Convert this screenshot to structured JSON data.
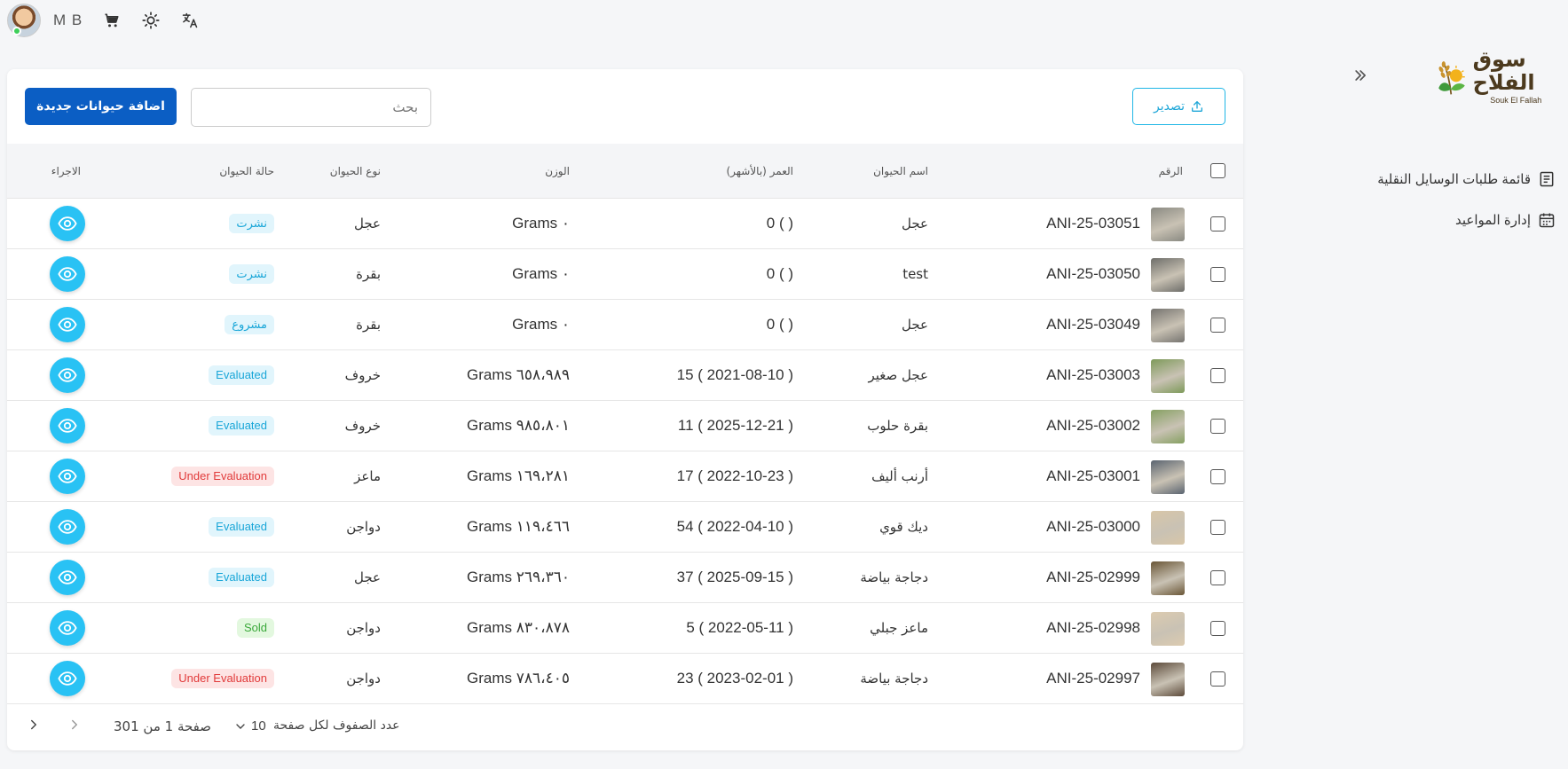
{
  "topbar": {
    "user_name": "M B"
  },
  "sidebar": {
    "logo_ar": "سوق الفلاح",
    "logo_en": "Souk El Fallah",
    "items": [
      {
        "label": "قائمة طلبات الوسايل النقلية"
      },
      {
        "label": "إدارة المواعيد"
      }
    ]
  },
  "toolbar": {
    "add_label": "اضافة حيوانات جديدة",
    "search_placeholder": "بحث",
    "export_label": "تصدير"
  },
  "table": {
    "headers": {
      "number": "الرقم",
      "name": "اسم الحيوان",
      "age": "العمر (بالأشهر)",
      "weight": "الوزن",
      "type": "نوع الحيوان",
      "status": "حالة الحيوان",
      "action": "الاجراء"
    },
    "rows": [
      {
        "id": "ANI-25-03051",
        "name": "عجل",
        "age": "0 ( )",
        "weight": "Grams ٠",
        "type": "عجل",
        "status": "نشرت",
        "status_color": "blue",
        "thumb": "#8a8a82"
      },
      {
        "id": "ANI-25-03050",
        "name": "test",
        "age": "0 ( )",
        "weight": "Grams ٠",
        "type": "بقرة",
        "status": "نشرت",
        "status_color": "blue",
        "thumb": "#6e6e6a"
      },
      {
        "id": "ANI-25-03049",
        "name": "عجل",
        "age": "0 ( )",
        "weight": "Grams ٠",
        "type": "بقرة",
        "status": "مشروع",
        "status_color": "blue",
        "thumb": "#767470"
      },
      {
        "id": "ANI-25-03003",
        "name": "عجل صغير",
        "age": "15 ( 2021-08-10 )",
        "weight": "Grams ٦٥٨،٩٨٩",
        "type": "خروف",
        "status": "Evaluated",
        "status_color": "blue",
        "thumb": "#7e9a5a"
      },
      {
        "id": "ANI-25-03002",
        "name": "بقرة حلوب",
        "age": "11 ( 2025-12-21 )",
        "weight": "Grams ٩٨٥،٨٠١",
        "type": "خروف",
        "status": "Evaluated",
        "status_color": "blue",
        "thumb": "#86a062"
      },
      {
        "id": "ANI-25-03001",
        "name": "أرنب أليف",
        "age": "17 ( 2022-10-23 )",
        "weight": "Grams ١٦٩،٢٨١",
        "type": "ماعز",
        "status": "Under Evaluation",
        "status_color": "red",
        "thumb": "#5a6470"
      },
      {
        "id": "ANI-25-03000",
        "name": "ديك قوي",
        "age": "54 ( 2022-04-10 )",
        "weight": "Grams ١١٩،٤٦٦",
        "type": "دواجن",
        "status": "Evaluated",
        "status_color": "blue",
        "thumb": "#d8c6a8"
      },
      {
        "id": "ANI-25-02999",
        "name": "دجاجة بياضة",
        "age": "37 ( 2025-09-15 )",
        "weight": "Grams ٢٦٩،٣٦٠",
        "type": "عجل",
        "status": "Evaluated",
        "status_color": "blue",
        "thumb": "#6a5636"
      },
      {
        "id": "ANI-25-02998",
        "name": "ماعز جبلي",
        "age": "5 ( 2022-05-11 )",
        "weight": "Grams ٨٣٠،٨٧٨",
        "type": "دواجن",
        "status": "Sold",
        "status_color": "green",
        "thumb": "#dccbb0"
      },
      {
        "id": "ANI-25-02997",
        "name": "دجاجة بياضة",
        "age": "23 ( 2023-02-01 )",
        "weight": "Grams ٧٨٦،٤٠٥",
        "type": "دواجن",
        "status": "Under Evaluation",
        "status_color": "red",
        "thumb": "#5c4a3a"
      }
    ]
  },
  "pagination": {
    "rows_per_page_label": "عدد الصفوف لكل صفحة",
    "rows_per_page": "10",
    "page_info": "صفحة 1 من 301"
  }
}
